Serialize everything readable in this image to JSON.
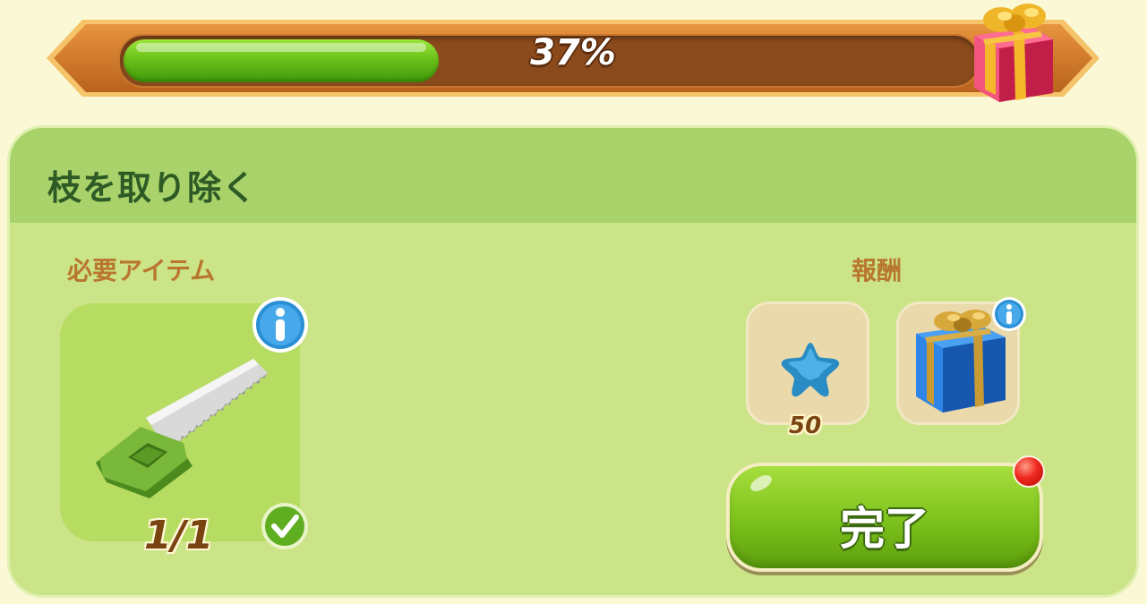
{
  "progress": {
    "label": "37%",
    "value": 0.37,
    "reward_icon": "gift-box-icon"
  },
  "task": {
    "title": "枝を取り除く",
    "required_label": "必要アイテム",
    "required_item": {
      "icon": "saw-icon",
      "count": "1/1",
      "completed": true
    },
    "rewards_label": "報酬",
    "rewards": [
      {
        "icon": "blue-star-icon",
        "amount": "50"
      },
      {
        "icon": "gift-box-icon"
      }
    ],
    "complete_button": "完了"
  },
  "colors": {
    "progress_fill": "#6cc11a",
    "panel": "#cbe487",
    "header": "#a9d36a",
    "title": "#2d5a25",
    "section_label": "#b9762e"
  }
}
